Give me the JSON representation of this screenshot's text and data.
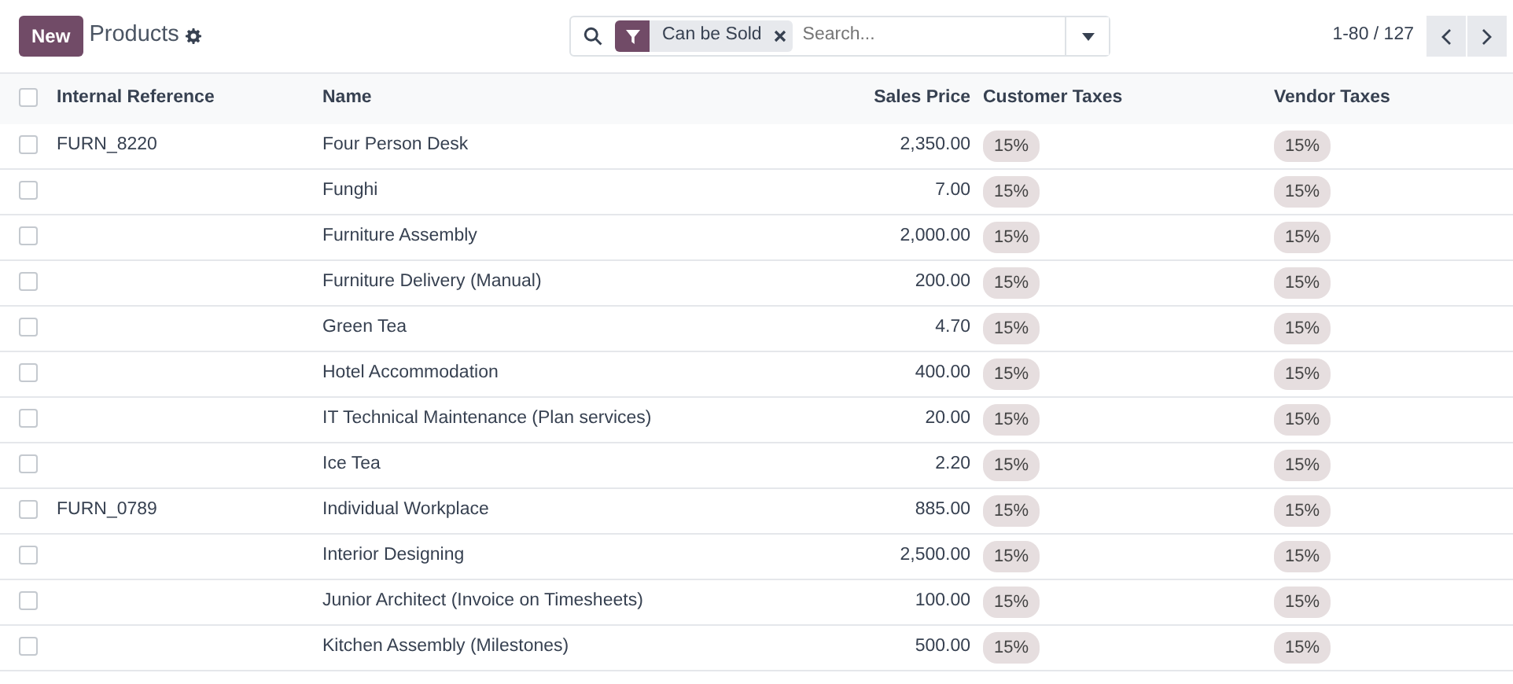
{
  "control_panel": {
    "new_button": "New",
    "title": "Products",
    "search": {
      "facets": [
        {
          "kind": "filter",
          "label": "Can be Sold"
        }
      ],
      "placeholder": "Search..."
    },
    "pager": {
      "value": "1-80 / 127"
    }
  },
  "table": {
    "columns": [
      "Internal Reference",
      "Name",
      "Sales Price",
      "Customer Taxes",
      "Vendor Taxes"
    ],
    "all_selected": false,
    "rows": [
      {
        "selected": false,
        "reference": "FURN_8220",
        "name": "Four Person Desk",
        "price": "2,350.00",
        "customer_taxes": "15%",
        "vendor_taxes": "15%"
      },
      {
        "selected": false,
        "name": "Funghi",
        "price": "7.00",
        "customer_taxes": "15%",
        "vendor_taxes": "15%"
      },
      {
        "selected": false,
        "name": "Furniture Assembly",
        "price": "2,000.00",
        "customer_taxes": "15%",
        "vendor_taxes": "15%"
      },
      {
        "selected": false,
        "name": "Furniture Delivery (Manual)",
        "price": "200.00",
        "customer_taxes": "15%",
        "vendor_taxes": "15%"
      },
      {
        "selected": false,
        "name": "Green Tea",
        "price": "4.70",
        "customer_taxes": "15%",
        "vendor_taxes": "15%"
      },
      {
        "selected": false,
        "name": "Hotel Accommodation",
        "price": "400.00",
        "customer_taxes": "15%",
        "vendor_taxes": "15%"
      },
      {
        "selected": false,
        "name": "IT Technical Maintenance (Plan services)",
        "price": "20.00",
        "customer_taxes": "15%",
        "vendor_taxes": "15%"
      },
      {
        "selected": false,
        "name": "Ice Tea",
        "price": "2.20",
        "customer_taxes": "15%",
        "vendor_taxes": "15%"
      },
      {
        "selected": false,
        "reference": "FURN_0789",
        "name": "Individual Workplace",
        "price": "885.00",
        "customer_taxes": "15%",
        "vendor_taxes": "15%"
      },
      {
        "selected": false,
        "name": "Interior Designing",
        "price": "2,500.00",
        "customer_taxes": "15%",
        "vendor_taxes": "15%"
      },
      {
        "selected": false,
        "name": "Junior Architect (Invoice on Timesheets)",
        "price": "100.00",
        "customer_taxes": "15%",
        "vendor_taxes": "15%"
      },
      {
        "selected": false,
        "name": "Kitchen Assembly (Milestones)",
        "price": "500.00",
        "customer_taxes": "15%",
        "vendor_taxes": "15%"
      }
    ]
  }
}
